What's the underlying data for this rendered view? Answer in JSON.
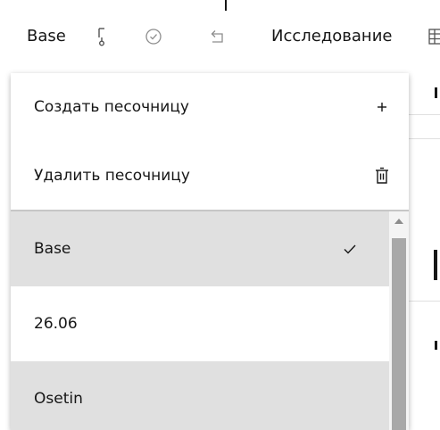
{
  "toolbar": {
    "base_label": "Base",
    "research_label": "Исследование"
  },
  "dropdown": {
    "actions": [
      {
        "label": "Создать песочницу",
        "icon": "plus-icon"
      },
      {
        "label": "Удалить песочницу",
        "icon": "trash-icon"
      }
    ],
    "options": [
      {
        "label": "Base",
        "selected": true
      },
      {
        "label": "26.06",
        "selected": false
      },
      {
        "label": "Osetin",
        "selected": false
      }
    ]
  },
  "colors": {
    "selected_bg": "#e0e0e0",
    "hover_bg": "#e8e8e8",
    "text": "#161616",
    "icon": "#525252",
    "scroll_thumb": "#a8a8a8"
  }
}
